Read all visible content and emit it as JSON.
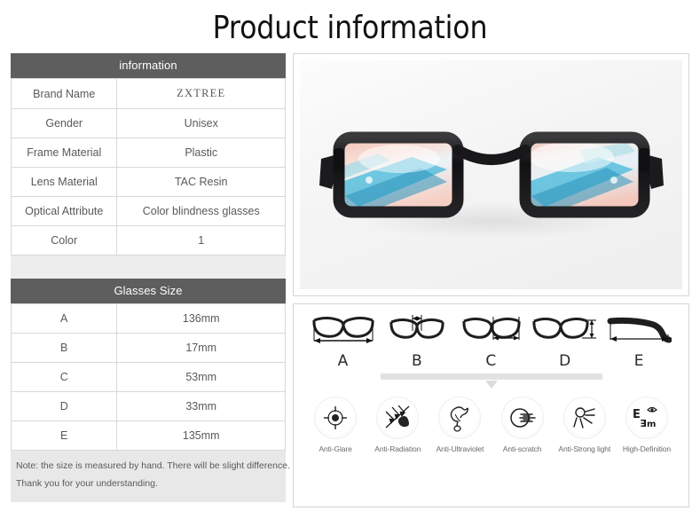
{
  "page": {
    "title": "Product information"
  },
  "info_table": {
    "caption": "information",
    "rows": [
      {
        "key": "Brand Name",
        "value": "ZXTREE"
      },
      {
        "key": "Gender",
        "value": "Unisex"
      },
      {
        "key": "Frame Material",
        "value": "Plastic"
      },
      {
        "key": "Lens Material",
        "value": "TAC Resin"
      },
      {
        "key": "Optical Attribute",
        "value": "Color blindness glasses"
      },
      {
        "key": "Color",
        "value": "1"
      }
    ]
  },
  "size_table": {
    "caption": "Glasses Size",
    "rows": [
      {
        "key": "A",
        "value": "136mm"
      },
      {
        "key": "B",
        "value": "17mm"
      },
      {
        "key": "C",
        "value": "53mm"
      },
      {
        "key": "D",
        "value": "33mm"
      },
      {
        "key": "E",
        "value": "135mm"
      }
    ]
  },
  "note": {
    "line1": "Note: the size is measured by hand. There will be slight difference.",
    "line2": "Thank you for your understanding."
  },
  "product_photo": {
    "alt": "Black frame color blindness glasses with pink and cyan tinted lenses",
    "frame_color": "#1a1a1a",
    "lens_pink": "#f0b6ab",
    "lens_cyan": "#3fb6d8",
    "background": "#f4f4f4"
  },
  "diagrams": {
    "items": [
      {
        "letter": "A",
        "icon": "glasses-total-width-diagram"
      },
      {
        "letter": "B",
        "icon": "glasses-bridge-width-diagram"
      },
      {
        "letter": "C",
        "icon": "glasses-lens-width-diagram"
      },
      {
        "letter": "D",
        "icon": "glasses-lens-height-diagram"
      },
      {
        "letter": "E",
        "icon": "glasses-temple-length-diagram"
      }
    ]
  },
  "features": {
    "items": [
      {
        "label": "Anti-Glare",
        "icon": "target-crosshair-icon"
      },
      {
        "label": "Anti-Radiation",
        "icon": "radiation-arrows-icon"
      },
      {
        "label": "Anti-Ultraviolet",
        "icon": "bird-dove-icon"
      },
      {
        "label": "Anti-scratch",
        "icon": "circle-speedlines-icon"
      },
      {
        "label": "Anti-Strong light",
        "icon": "sun-rays-icon"
      },
      {
        "label": "High-Definition",
        "icon": "eye-chart-icon"
      }
    ]
  },
  "colors": {
    "header_bar": "#5e5e5e",
    "table_border": "#d8d8d8",
    "note_background": "#e8e8e8",
    "panel_border": "#d5d5d5",
    "text": "#595959"
  }
}
